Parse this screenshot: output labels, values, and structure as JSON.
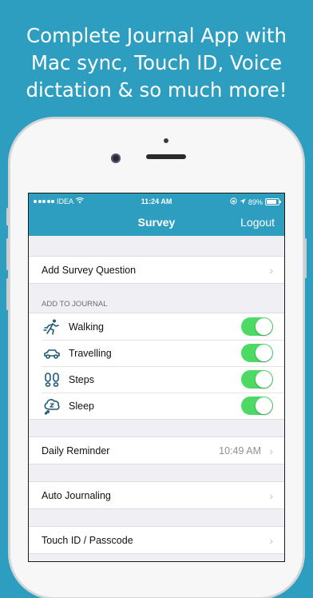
{
  "promo": {
    "line1": "Complete Journal App with",
    "line2": "Mac sync, Touch ID, Voice",
    "line3": "dictation & so much more!"
  },
  "statusbar": {
    "carrier": "IDEA",
    "time": "11:24 AM",
    "battery": "89%",
    "battery_level": 0.89
  },
  "navbar": {
    "title": "Survey",
    "logout_label": "Logout"
  },
  "rows": {
    "add_survey": "Add Survey Question",
    "journal_header": "ADD TO JOURNAL",
    "journal_items": [
      {
        "label": "Walking",
        "icon": "walking-icon",
        "enabled": true
      },
      {
        "label": "Travelling",
        "icon": "car-icon",
        "enabled": true
      },
      {
        "label": "Steps",
        "icon": "footprints-icon",
        "enabled": true
      },
      {
        "label": "Sleep",
        "icon": "sleep-icon",
        "enabled": true
      }
    ],
    "daily_reminder": "Daily Reminder",
    "daily_reminder_time": "10:49 AM",
    "auto_journaling": "Auto Journaling",
    "touch_id": "Touch ID / Passcode"
  },
  "colors": {
    "background": "#2e9ec0",
    "accent": "#2e9ec0",
    "toggle_on": "#4cd964",
    "icon": "#1e5a78"
  }
}
